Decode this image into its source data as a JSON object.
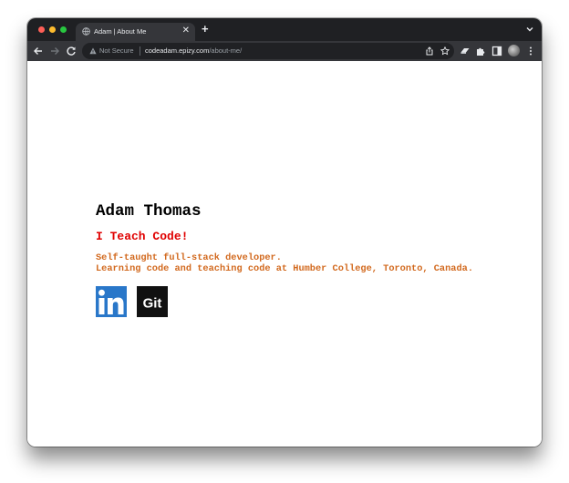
{
  "browser": {
    "tab": {
      "title": "Adam | About Me",
      "close": "✕",
      "icon": "globe-icon"
    },
    "new_tab": "+",
    "address": {
      "security_label": "Not Secure",
      "url_host": "codeadam.epizy.com",
      "url_path": "/about-me/"
    },
    "toolbar_icons": [
      "back-arrow-icon",
      "forward-arrow-icon",
      "reload-icon",
      "share-icon",
      "star-icon",
      "extension-icon",
      "puzzle-icon",
      "side-panel-icon",
      "profile-avatar",
      "kebab-menu-icon"
    ]
  },
  "page": {
    "name": "Adam Thomas",
    "tagline": "I Teach Code!",
    "description": [
      "Self-taught full-stack developer.",
      "Learning code and teaching code at Humber College, Toronto, Canada."
    ],
    "links": [
      {
        "label": "in",
        "service": "LinkedIn",
        "color": "#2977c9"
      },
      {
        "label": "Git",
        "service": "GitHub",
        "color": "#111111"
      }
    ]
  },
  "colors": {
    "tagline": "#e00000",
    "description": "#d2691e",
    "chrome_dark": "#1f2023",
    "chrome_toolbar": "#35363a"
  }
}
